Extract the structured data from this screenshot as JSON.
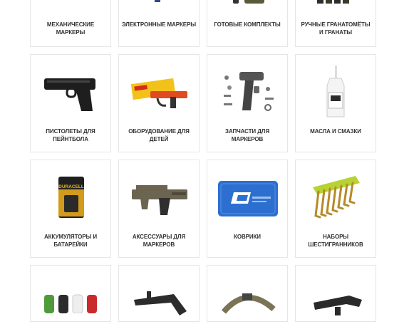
{
  "categories_top": [
    {
      "label": "МЕХАНИЧЕСКИЕ МАРКЕРЫ",
      "icon": "mechanical-marker-image"
    },
    {
      "label": "ЭЛЕКТРОННЫЕ МАРКЕРЫ",
      "icon": "electronic-marker-image"
    },
    {
      "label": "ГОТОВЫЕ КОМПЛЕКТЫ",
      "icon": "ready-kit-image"
    },
    {
      "label": "РУЧНЫЕ ГРАНАТОМЁТЫ И ГРАНАТЫ",
      "icon": "grenade-launcher-image"
    }
  ],
  "categories_mid": [
    {
      "label": "ПИСТОЛЕТЫ ДЛЯ ПЕЙНТБОЛА",
      "icon": "paintball-pistol-image"
    },
    {
      "label": "ОБОРУДОВАНИЕ ДЛЯ ДЕТЕЙ",
      "icon": "kids-equipment-image"
    },
    {
      "label": "ЗАПЧАСТИ ДЛЯ МАРКЕРОВ",
      "icon": "marker-parts-image"
    },
    {
      "label": "МАСЛА И СМАЗКИ",
      "icon": "oil-bottle-image"
    }
  ],
  "categories_low": [
    {
      "label": "АККУМУЛЯТОРЫ И БАТАРЕЙКИ",
      "icon": "battery-image"
    },
    {
      "label": "АКСЕССУАРЫ ДЛЯ МАРКЕРОВ",
      "icon": "marker-accessories-image"
    },
    {
      "label": "КОВРИКИ",
      "icon": "mat-image"
    },
    {
      "label": "НАБОРЫ ШЕСТИГРАННИКОВ",
      "icon": "hex-key-set-image"
    }
  ],
  "categories_bottom": [
    {
      "label": "",
      "icon": "grips-image"
    },
    {
      "label": "",
      "icon": "stock-image"
    },
    {
      "label": "",
      "icon": "sling-image"
    },
    {
      "label": "",
      "icon": "barrel-image"
    }
  ],
  "battery_brand": "DURACELL"
}
